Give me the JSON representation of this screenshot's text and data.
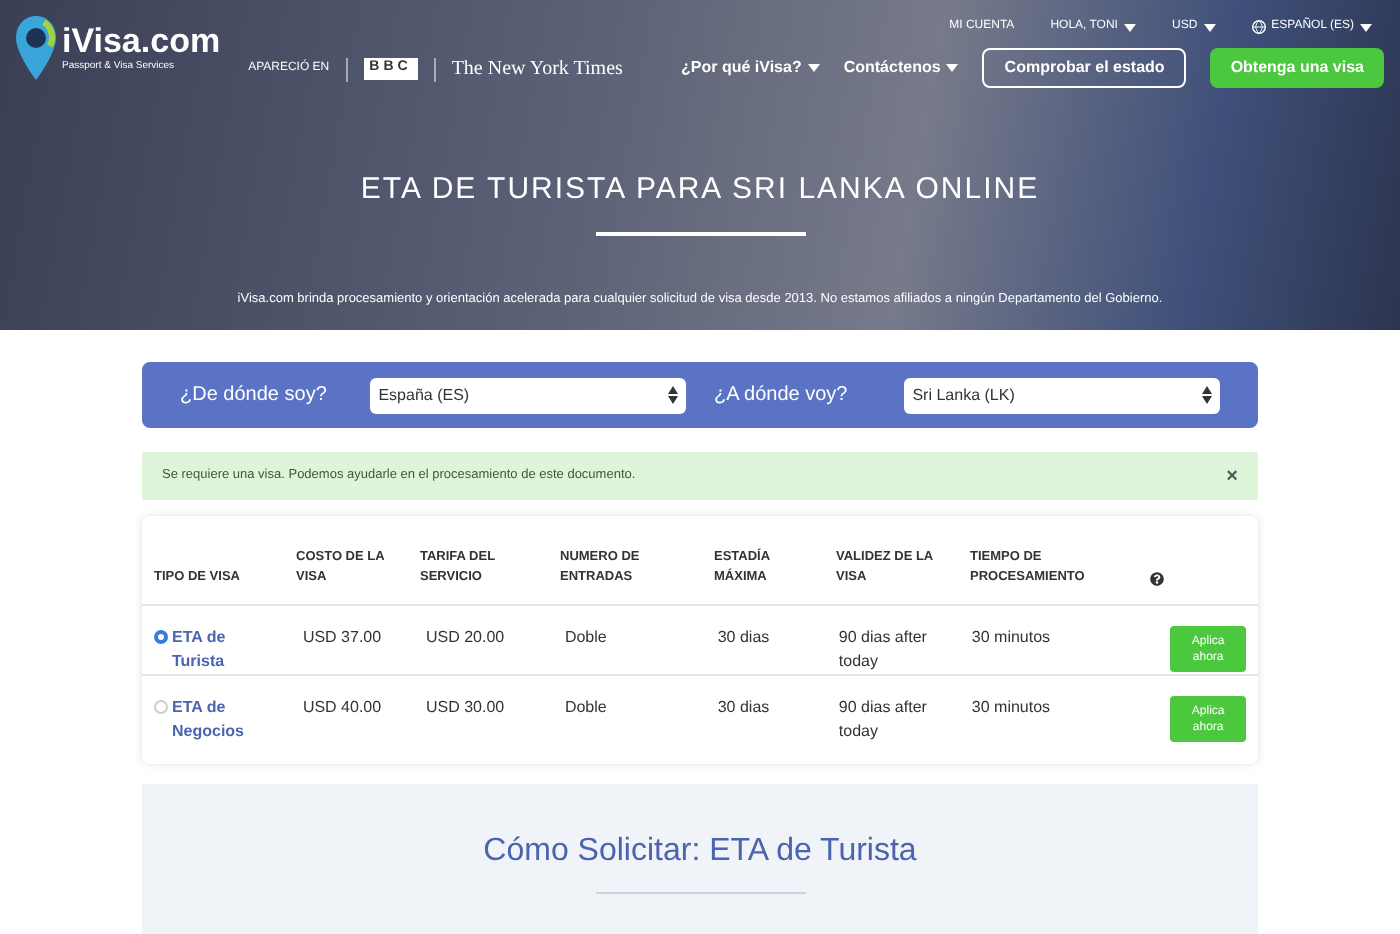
{
  "header": {
    "logo": {
      "name": "iVisa.com",
      "tagline": "Passport & Visa Services"
    },
    "featured_label": "APARECIÓ EN",
    "press": [
      "BBC",
      "The New York Times"
    ],
    "top_links": [
      {
        "label": "MI CUENTA",
        "dropdown": false
      },
      {
        "label": "HOLA, TONI",
        "dropdown": true
      },
      {
        "label": "USD",
        "dropdown": true
      },
      {
        "label": "ESPAÑOL (ES)",
        "dropdown": true
      }
    ],
    "nav": [
      {
        "label": "¿Por qué iVisa?",
        "kind": "menu"
      },
      {
        "label": "Contáctenos",
        "kind": "menu"
      },
      {
        "label": "Comprobar el estado",
        "kind": "outline"
      },
      {
        "label": "Obtenga una visa",
        "kind": "primary"
      }
    ]
  },
  "hero": {
    "title": "ETA DE TURISTA PARA SRI LANKA ONLINE",
    "subtitle": "iVisa.com brinda procesamiento y orientación acelerada para cualquier solicitud de visa desde 2013. No estamos afiliados a ningún Departamento del Gobierno."
  },
  "selector": {
    "from_label": "¿De dónde soy?",
    "from_value": "España (ES)",
    "to_label": "¿A dónde voy?",
    "to_value": "Sri Lanka (LK)"
  },
  "alert": {
    "text": "Se requiere una visa. Podemos ayudarle en el procesamiento de este documento.",
    "close": "×"
  },
  "table": {
    "columns": [
      "TIPO DE VISA",
      "COSTO DE LA VISA",
      "TARIFA DEL SERVICIO",
      "NUMERO DE ENTRADAS",
      "ESTADÍA MÁXIMA",
      "VALIDEZ DE LA VISA",
      "TIEMPO DE PROCESAMIENTO"
    ],
    "rows": [
      {
        "selected": true,
        "type": "ETA de Turista",
        "cost": "USD 37.00",
        "fee": "USD 20.00",
        "entries": "Doble",
        "stay": "30 dias",
        "validity": "90 dias after today",
        "processing": "30 minutos",
        "action": "Aplica ahora"
      },
      {
        "selected": false,
        "type": "ETA de Negocios",
        "cost": "USD 40.00",
        "fee": "USD 30.00",
        "entries": "Doble",
        "stay": "30 dias",
        "validity": "90 dias after today",
        "processing": "30 minutos",
        "action": "Aplica ahora"
      }
    ]
  },
  "how_to": {
    "title": "Cómo Solicitar: ETA de Turista"
  }
}
